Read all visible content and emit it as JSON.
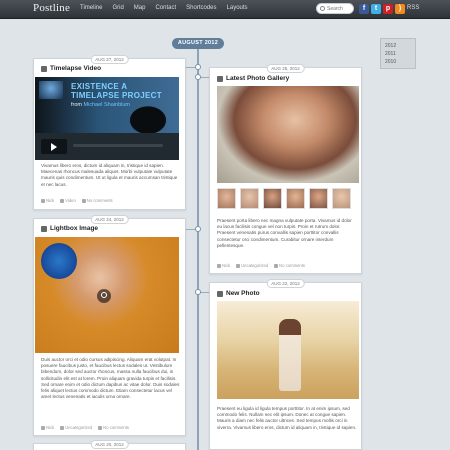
{
  "header": {
    "logo": "Postline",
    "nav": [
      "Timeline",
      "Grid",
      "Map",
      "Contact",
      "Shortcodes",
      "Layouts"
    ],
    "search_placeholder": "Search",
    "social": [
      {
        "name": "facebook",
        "glyph": "f",
        "color": "#3b5998"
      },
      {
        "name": "twitter",
        "glyph": "t",
        "color": "#3fb0e6"
      },
      {
        "name": "pinterest",
        "glyph": "p",
        "color": "#cb2027"
      },
      {
        "name": "rss",
        "glyph": ")",
        "color": "#f28b1e"
      }
    ],
    "rss_label": "RSS"
  },
  "timeline": {
    "month": "AUGUST 2012",
    "years": [
      "2012",
      "2011",
      "2010"
    ]
  },
  "posts": {
    "timelapse": {
      "date": "AUG 27, 2012",
      "title": "Timelapse Video",
      "video": {
        "line1": "EXISTENCE A",
        "line2": "TIMELAPSE PROJECT",
        "from": "from",
        "author": "Michael Shainblum"
      },
      "excerpt": "Vivamus libero eros, dictum id aliquam in, tristique id sapien. Maecenas rhoncus malesuada aliquet. Morbi vulputate vulputate mauris quis condimentum. Ut ut ligula et mauris accumsan tristique et nec lacus.",
      "meta": {
        "author": "Nick",
        "category": "Video",
        "comments": "No comments"
      }
    },
    "gallery": {
      "date": "AUG 25, 2012",
      "title": "Latest Photo Gallery",
      "excerpt": "Praesent porta libero nec magna vulputate porta. Vivamus id dolor eu lacus facilisis congue vel non turpis. Proin et rutrum dolor. Praesent venenatis purus convallis sapien porttitor convallis consectetur orci condimentum. Curabitur ornare interdum pellentesque.",
      "meta": {
        "author": "Nick",
        "category": "Uncategorized",
        "comments": "No comments"
      }
    },
    "lightbox": {
      "date": "AUG 24, 2012",
      "title": "Lightbox Image",
      "excerpt": "Duis auctor orci et odio cursus adipiscing. Aliquam erat volutpat. In posuere faucibus justo, et faucibus lectus sodales ut. Vestibulum bibendum, dolor sed auctor rhoncus, massa nulla faucibus dui, in sollicitudin elit est at lorem. Proin aliquam gravida turpis et facilisis. Sed ornare enim et odio dictum dapibus ac vitae dolor. Duis sodales felis aliquet lectus commodo dictum. Etiam consectetur lacus vel amet lectus venenatis et iaculis urna ornare.",
      "meta": {
        "author": "Nick",
        "category": "Uncategorized",
        "comments": "No comments"
      }
    },
    "newphoto": {
      "date": "AUG 22, 2012",
      "title": "New Photo",
      "excerpt": "Praesent eu ligula id ligula tempus porttitor. In at enim ipsum, sed commodo felis. Nullam nec elit ipsum. Donec at congue sapien. Mauris a diam nec felis auctor ultrices. Sed tempus mollis orci in viverra. Vivamus libero eros, dictum id aliquam in, tristique id sapien."
    },
    "next": {
      "date": "AUG 20, 2012"
    }
  }
}
